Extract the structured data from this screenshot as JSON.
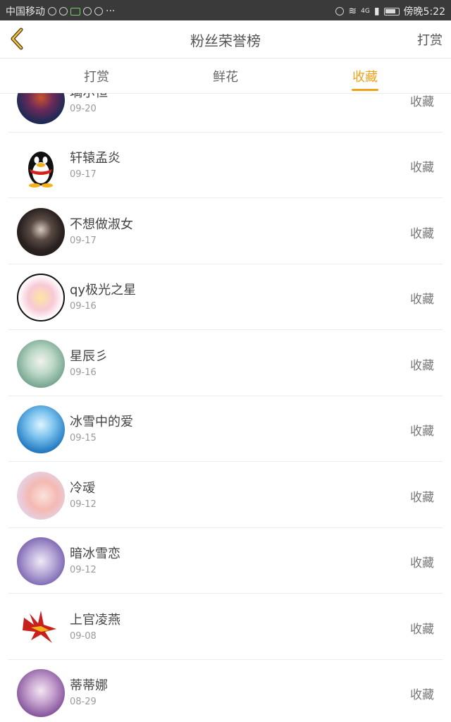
{
  "status_bar": {
    "carrier": "中国移动",
    "network": "4G",
    "time": "傍晚5:22"
  },
  "header": {
    "title": "粉丝荣誉榜",
    "right_action": "打赏"
  },
  "tabs": [
    {
      "label": "打赏",
      "active": false
    },
    {
      "label": "鲜花",
      "active": false
    },
    {
      "label": "收藏",
      "active": true
    }
  ],
  "accent_color": "#f0a21b",
  "entries": [
    {
      "name": "璃尔恒",
      "date": "09-20",
      "action": "收藏"
    },
    {
      "name": "轩辕孟炎",
      "date": "09-17",
      "action": "收藏"
    },
    {
      "name": "不想做淑女",
      "date": "09-17",
      "action": "收藏"
    },
    {
      "name": "qy极光之星",
      "date": "09-16",
      "action": "收藏"
    },
    {
      "name": "星辰彡",
      "date": "09-16",
      "action": "收藏"
    },
    {
      "name": "冰雪中的爱",
      "date": "09-15",
      "action": "收藏"
    },
    {
      "name": "冷叆",
      "date": "09-12",
      "action": "收藏"
    },
    {
      "name": "暗冰雪恋",
      "date": "09-12",
      "action": "收藏"
    },
    {
      "name": "上官凌燕",
      "date": "09-08",
      "action": "收藏"
    },
    {
      "name": "蒂蒂娜",
      "date": "08-29",
      "action": "收藏"
    }
  ]
}
